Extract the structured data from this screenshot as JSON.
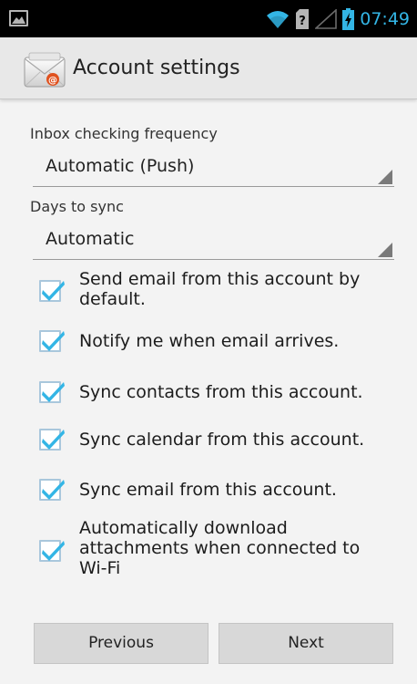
{
  "status_bar": {
    "time": "07:49",
    "icons": [
      "picture-icon",
      "wifi-icon",
      "no-sim-icon",
      "signal-icon",
      "battery-charging-icon"
    ],
    "accent_color": "#33b5e5"
  },
  "header": {
    "title": "Account settings",
    "icon": "email-app-icon"
  },
  "settings": {
    "inbox_frequency": {
      "label": "Inbox checking frequency",
      "value": "Automatic (Push)"
    },
    "days_to_sync": {
      "label": "Days to sync",
      "value": "Automatic"
    },
    "options": [
      {
        "line1": "Send email from this account by",
        "line2": "default.",
        "line3": "",
        "checked": true
      },
      {
        "line1": "Notify me when email arrives.",
        "line2": "",
        "line3": "",
        "checked": true
      },
      {
        "line1": "Sync contacts from this account.",
        "line2": "",
        "line3": "",
        "checked": true
      },
      {
        "line1": "Sync calendar from this account.",
        "line2": "",
        "line3": "",
        "checked": true
      },
      {
        "line1": "Sync email from this account.",
        "line2": "",
        "line3": "",
        "checked": true
      },
      {
        "line1": "Automatically download",
        "line2": "attachments when connected to",
        "line3": "Wi-Fi",
        "checked": true
      }
    ]
  },
  "buttons": {
    "previous": "Previous",
    "next": "Next"
  }
}
